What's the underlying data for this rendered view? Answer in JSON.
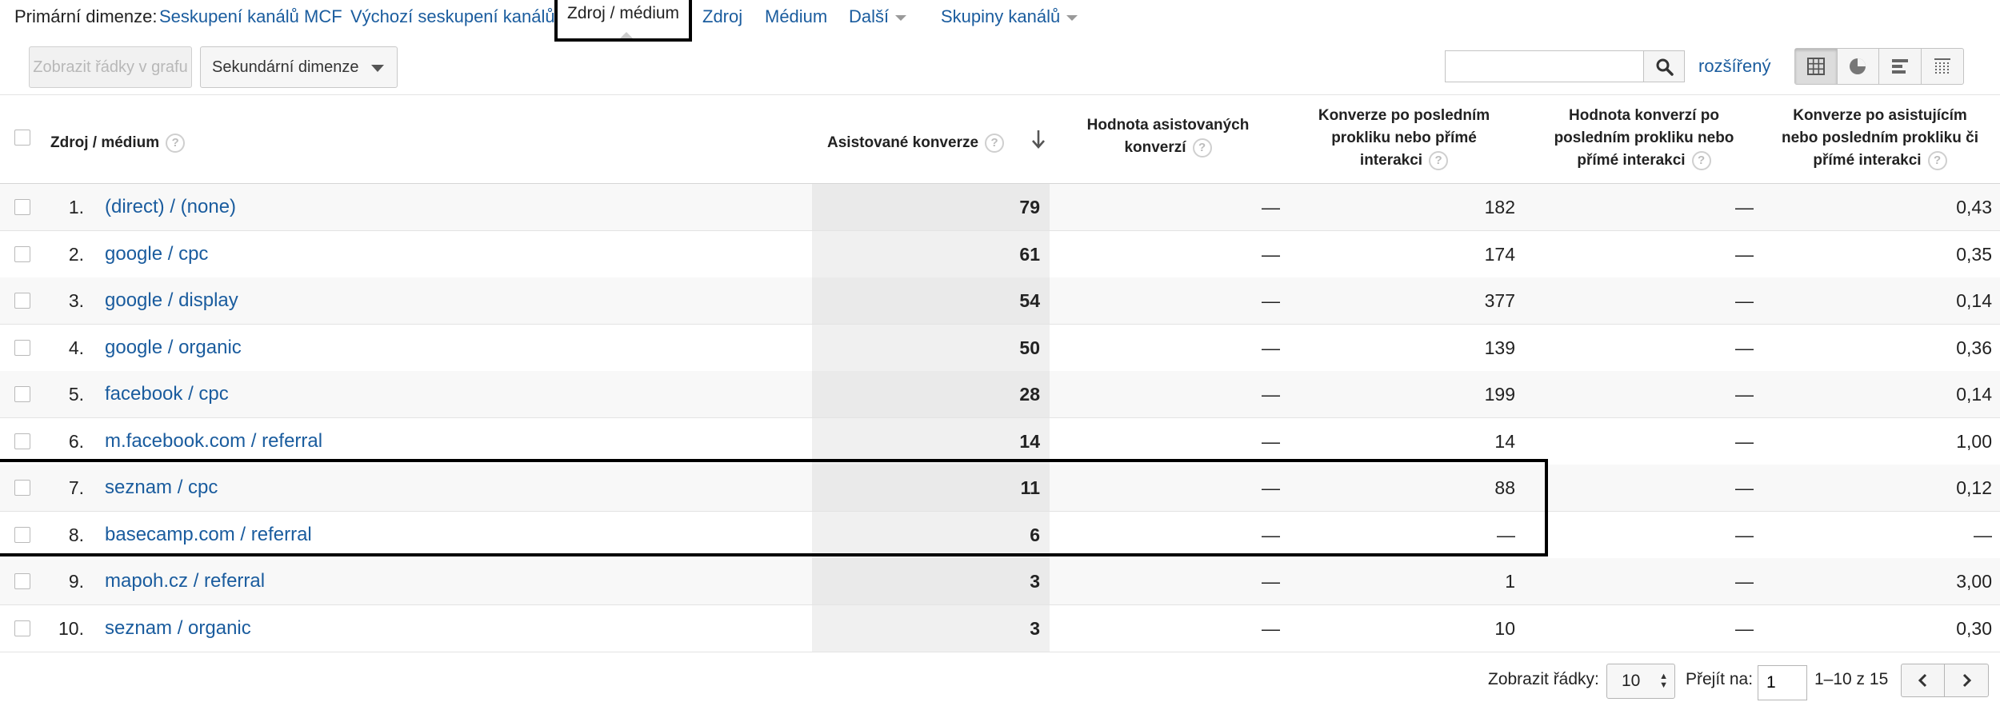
{
  "primary_dimension": {
    "label": "Primární dimenze:",
    "links": [
      "Seskupení kanálů MCF",
      "Výchozí seskupení kanálů"
    ],
    "active": "Zdroj / médium",
    "links_after": [
      "Zdroj",
      "Médium"
    ],
    "more": "Další",
    "groups": "Skupiny kanálů"
  },
  "toolbar": {
    "plot_rows": "Zobrazit řádky v grafu",
    "secondary_dimension": "Sekundární dimenze",
    "search_placeholder": "",
    "advanced": "rozšířený"
  },
  "table": {
    "headers": {
      "source": "Zdroj / médium",
      "assisted": "Asistované konverze",
      "assisted_value": [
        "Hodnota asistovaných",
        "konverzí"
      ],
      "last_click": [
        "Konverze po posledním",
        "prokliku nebo přímé",
        "interakci"
      ],
      "last_click_value": [
        "Hodnota konverzí po",
        "posledním prokliku nebo",
        "přímé interakci"
      ],
      "ratio": [
        "Konverze po asistujícím",
        "nebo posledním prokliku či",
        "přímé interakci"
      ]
    },
    "help_glyph": "?",
    "rows": [
      {
        "num": "1.",
        "source": "(direct) / (none)",
        "assisted": "79",
        "assisted_value": "—",
        "last_click": "182",
        "last_click_value": "—",
        "ratio": "0,43"
      },
      {
        "num": "2.",
        "source": "google / cpc",
        "assisted": "61",
        "assisted_value": "—",
        "last_click": "174",
        "last_click_value": "—",
        "ratio": "0,35"
      },
      {
        "num": "3.",
        "source": "google / display",
        "assisted": "54",
        "assisted_value": "—",
        "last_click": "377",
        "last_click_value": "—",
        "ratio": "0,14"
      },
      {
        "num": "4.",
        "source": "google / organic",
        "assisted": "50",
        "assisted_value": "—",
        "last_click": "139",
        "last_click_value": "—",
        "ratio": "0,36"
      },
      {
        "num": "5.",
        "source": "facebook / cpc",
        "assisted": "28",
        "assisted_value": "—",
        "last_click": "199",
        "last_click_value": "—",
        "ratio": "0,14"
      },
      {
        "num": "6.",
        "source": "m.facebook.com / referral",
        "assisted": "14",
        "assisted_value": "—",
        "last_click": "14",
        "last_click_value": "—",
        "ratio": "1,00"
      },
      {
        "num": "7.",
        "source": "seznam / cpc",
        "assisted": "11",
        "assisted_value": "—",
        "last_click": "88",
        "last_click_value": "—",
        "ratio": "0,12"
      },
      {
        "num": "8.",
        "source": "basecamp.com / referral",
        "assisted": "6",
        "assisted_value": "—",
        "last_click": "—",
        "last_click_value": "—",
        "ratio": "—"
      },
      {
        "num": "9.",
        "source": "mapoh.cz / referral",
        "assisted": "3",
        "assisted_value": "—",
        "last_click": "1",
        "last_click_value": "—",
        "ratio": "3,00"
      },
      {
        "num": "10.",
        "source": "seznam / organic",
        "assisted": "3",
        "assisted_value": "—",
        "last_click": "10",
        "last_click_value": "—",
        "ratio": "0,30"
      }
    ]
  },
  "footer": {
    "show_rows_label": "Zobrazit řádky:",
    "show_rows_value": "10",
    "goto_label": "Přejít na:",
    "goto_value": "1",
    "range": "1–10 z 15"
  },
  "colors": {
    "link": "#1a5c9e",
    "sorted_column": "#f0f0f0",
    "highlight_border": "#000000"
  }
}
